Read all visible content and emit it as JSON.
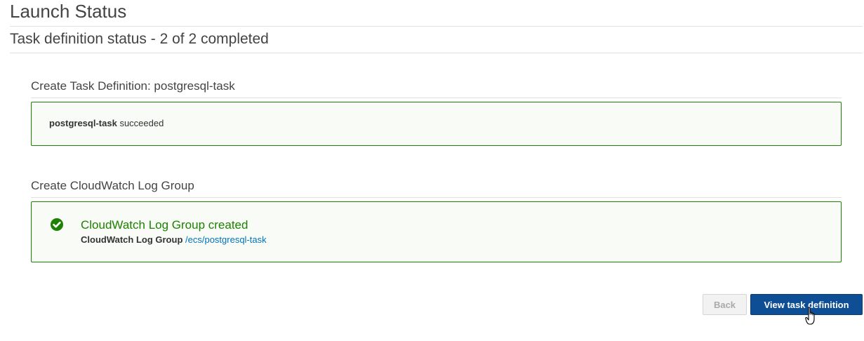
{
  "page": {
    "title": "Launch Status",
    "subtitle": "Task definition status - 2 of 2 completed"
  },
  "sections": [
    {
      "heading": "Create Task Definition: postgresql-task",
      "result_name": "postgresql-task",
      "result_status": "succeeded"
    },
    {
      "heading": "Create CloudWatch Log Group",
      "success_title": "CloudWatch Log Group created",
      "detail_label": "CloudWatch Log Group",
      "detail_link": "/ecs/postgresql-task",
      "icon": "check-circle-icon"
    }
  ],
  "buttons": {
    "back_label": "Back",
    "primary_label": "View task definition"
  },
  "colors": {
    "success": "#1d8102",
    "primary_button": "#0e4e94",
    "link": "#0073bb"
  }
}
